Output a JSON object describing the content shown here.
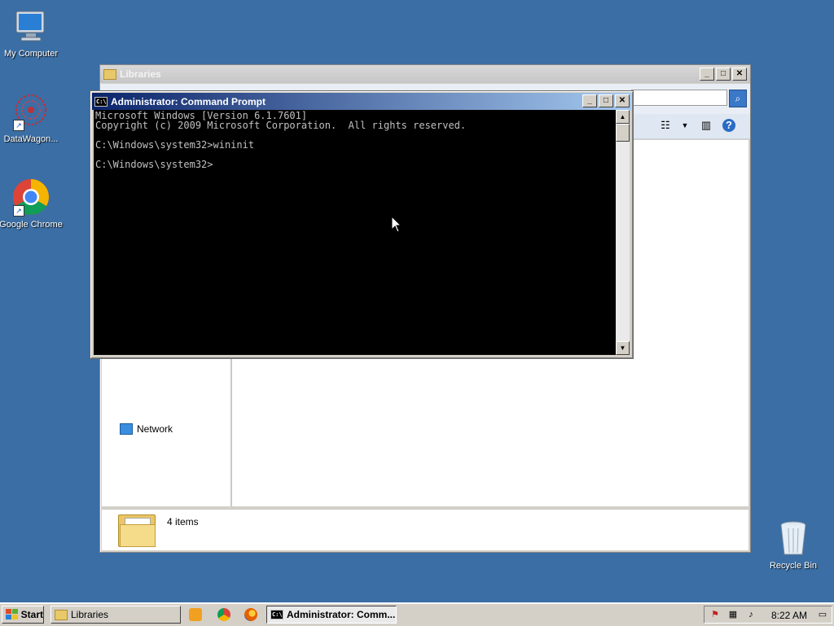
{
  "desktop": {
    "icons": [
      {
        "label": "My Computer",
        "icon": "my-computer-icon"
      },
      {
        "label": "DataWagon...",
        "icon": "datawagon-icon"
      },
      {
        "label": "Google Chrome",
        "icon": "chrome-icon"
      },
      {
        "label": "Recycle Bin",
        "icon": "recycle-bin-icon"
      }
    ]
  },
  "explorer": {
    "title": "Libraries",
    "nav": {
      "network_label": "Network"
    },
    "details": {
      "count": "4 items"
    }
  },
  "cmd": {
    "title": "Administrator: Command Prompt",
    "lines": [
      "Microsoft Windows [Version 6.1.7601]",
      "Copyright (c) 2009 Microsoft Corporation.  All rights reserved.",
      "",
      "C:\\Windows\\system32>wininit",
      "",
      "C:\\Windows\\system32>"
    ]
  },
  "window_controls": {
    "minimize": "_",
    "maximize": "□",
    "close": "✕"
  },
  "taskbar": {
    "start_label": "Start",
    "tasks": [
      {
        "label": "Libraries",
        "active": false
      },
      {
        "label": "Administrator: Comm...",
        "active": true
      }
    ],
    "quick_launch": [
      "media-player-icon",
      "chrome-icon",
      "firefox-icon"
    ],
    "tray_icons": [
      "action-center-icon",
      "network-icon",
      "volume-icon",
      "show-desktop-icon"
    ],
    "clock": "8:22 AM"
  },
  "colors": {
    "desktop": "#3a6ea5",
    "cmd_title_start": "#0a246a",
    "cmd_title_end": "#a6caf0",
    "console_bg": "#000000",
    "console_text": "#c0c0c0"
  }
}
